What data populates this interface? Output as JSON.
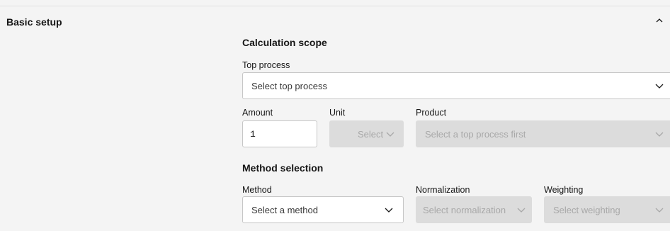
{
  "panel": {
    "title": "Basic setup",
    "collapse_icon": "chevron-up-icon"
  },
  "calculation_scope": {
    "heading": "Calculation scope",
    "top_process": {
      "label": "Top process",
      "placeholder": "Select top process"
    },
    "amount": {
      "label": "Amount",
      "value": "1"
    },
    "unit": {
      "label": "Unit",
      "placeholder": "Select",
      "disabled": true
    },
    "product": {
      "label": "Product",
      "placeholder": "Select a top process first",
      "disabled": true
    }
  },
  "method_selection": {
    "heading": "Method selection",
    "method": {
      "label": "Method",
      "placeholder": "Select a method"
    },
    "normalization": {
      "label": "Normalization",
      "placeholder": "Select normalization",
      "disabled": true
    },
    "weighting": {
      "label": "Weighting",
      "placeholder": "Select weighting",
      "disabled": true
    }
  },
  "colors": {
    "panel_bg": "#f4f4f4",
    "field_bg": "#ffffff",
    "disabled_bg": "#dcdcdc",
    "disabled_text": "#a8a8a8"
  }
}
